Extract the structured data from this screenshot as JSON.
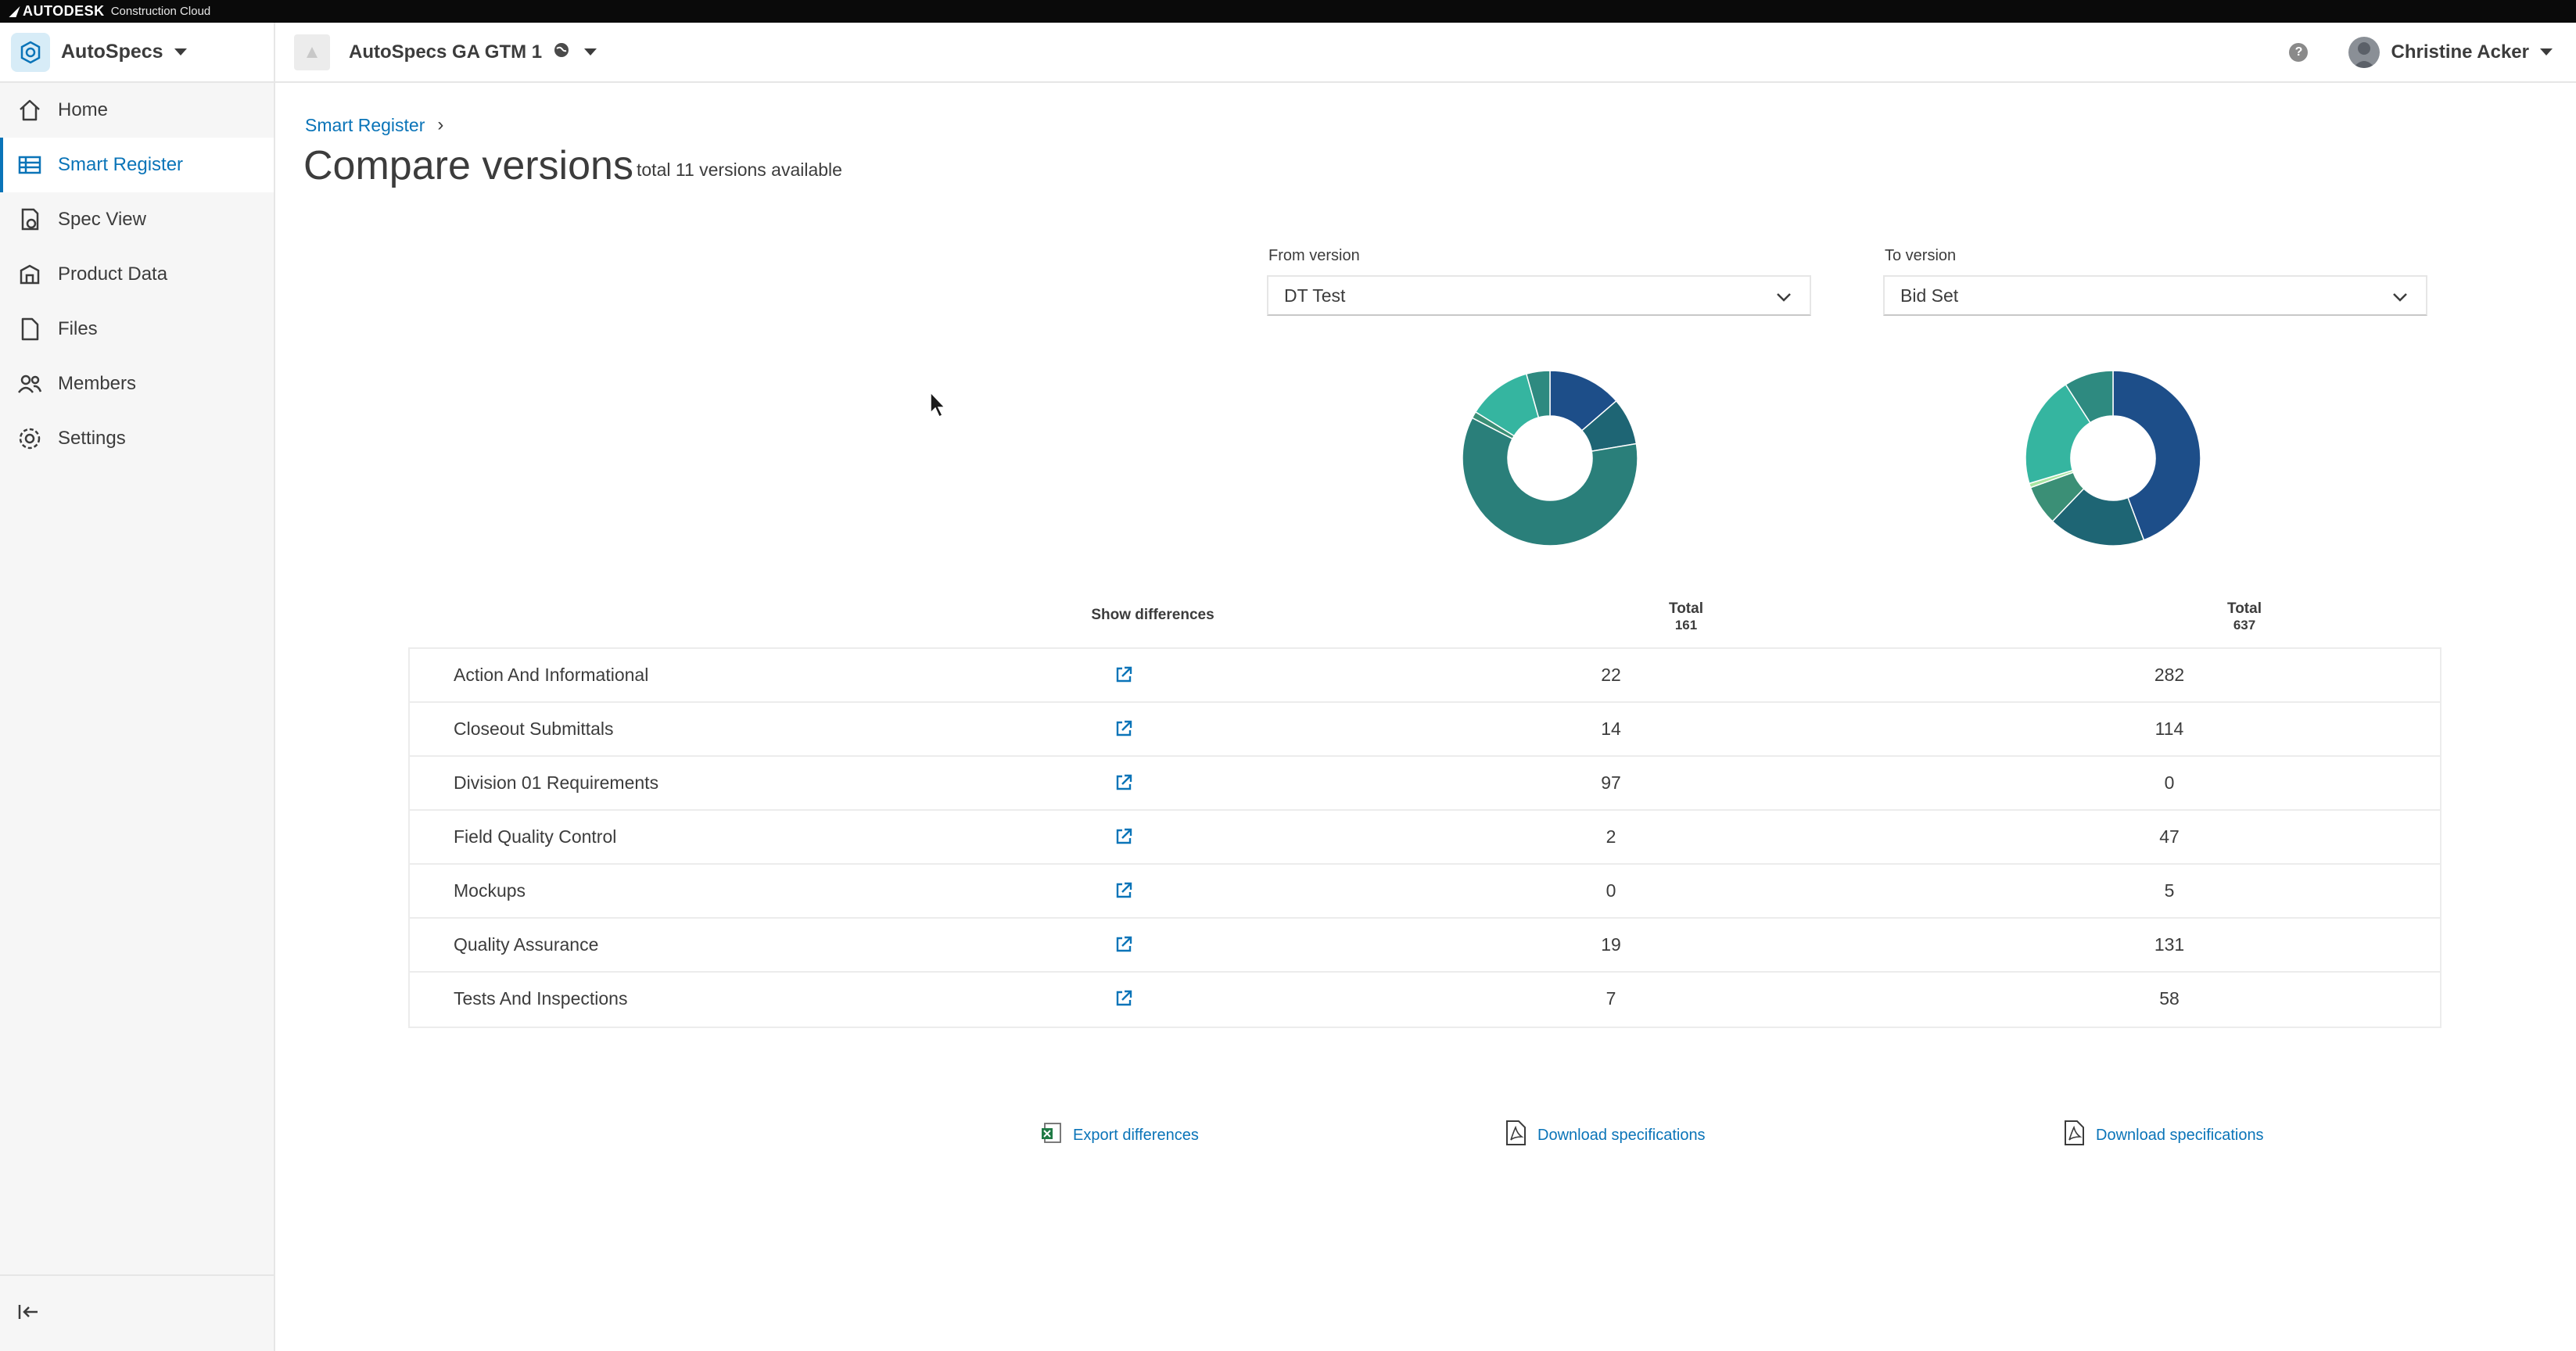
{
  "brand": {
    "name": "AUTODESK",
    "product": "Construction Cloud"
  },
  "header": {
    "app_name": "AutoSpecs",
    "project_name": "AutoSpecs GA GTM 1",
    "help_label": "?",
    "user_name": "Christine Acker"
  },
  "sidebar": {
    "items": [
      {
        "label": "Home",
        "icon": "home-icon"
      },
      {
        "label": "Smart Register",
        "icon": "table-icon",
        "active": true
      },
      {
        "label": "Spec View",
        "icon": "spec-view-icon"
      },
      {
        "label": "Product Data",
        "icon": "product-data-icon"
      },
      {
        "label": "Files",
        "icon": "file-icon"
      },
      {
        "label": "Members",
        "icon": "members-icon"
      },
      {
        "label": "Settings",
        "icon": "gear-icon"
      }
    ],
    "collapse_icon": "collapse-icon"
  },
  "page": {
    "breadcrumb": "Smart Register",
    "title": "Compare versions",
    "subtitle": "total 11 versions available"
  },
  "compare": {
    "from_label": "From version",
    "from_value": "DT Test",
    "to_label": "To version",
    "to_value": "Bid Set",
    "show_differences": "Show differences",
    "total_label": "Total",
    "from_total": "161",
    "to_total": "637",
    "rows": [
      {
        "name": "Action And Informational",
        "from": "22",
        "to": "282"
      },
      {
        "name": "Closeout Submittals",
        "from": "14",
        "to": "114"
      },
      {
        "name": "Division 01 Requirements",
        "from": "97",
        "to": "0"
      },
      {
        "name": "Field Quality Control",
        "from": "2",
        "to": "47"
      },
      {
        "name": "Mockups",
        "from": "0",
        "to": "5"
      },
      {
        "name": "Quality Assurance",
        "from": "19",
        "to": "131"
      },
      {
        "name": "Tests And Inspections",
        "from": "7",
        "to": "58"
      }
    ],
    "export_label": "Export differences",
    "download_from_label": "Download specifications",
    "download_to_label": "Download specifications"
  },
  "colors": {
    "accent": "#0a74b8",
    "slices": [
      "#1d4e89",
      "#1e6574",
      "#2a7f7a",
      "#3b8f76",
      "#a8e6a1",
      "#35b5a0",
      "#2e8a80"
    ]
  },
  "chart_data": [
    {
      "type": "pie",
      "categories": [
        "Action And Informational",
        "Closeout Submittals",
        "Division 01 Requirements",
        "Field Quality Control",
        "Mockups",
        "Quality Assurance",
        "Tests And Inspections"
      ],
      "values": [
        22,
        14,
        97,
        2,
        0,
        19,
        7
      ]
    },
    {
      "type": "pie",
      "categories": [
        "Action And Informational",
        "Closeout Submittals",
        "Division 01 Requirements",
        "Field Quality Control",
        "Mockups",
        "Quality Assurance",
        "Tests And Inspections"
      ],
      "values": [
        282,
        114,
        0,
        47,
        5,
        131,
        58
      ]
    }
  ]
}
